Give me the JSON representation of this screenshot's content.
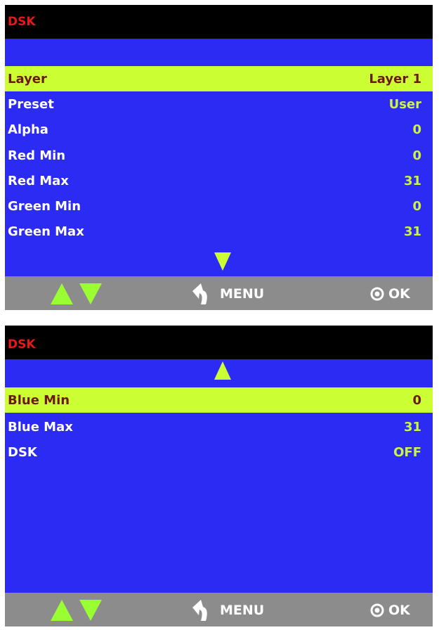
{
  "colors": {
    "screen_bg": "#2b2bf3",
    "title_bg": "#000000",
    "title_text": "#e81818",
    "selected_bg": "#ccff33",
    "selected_text": "#6b1a0e",
    "value_text": "#ccf542",
    "bottom_bar": "#8c8c8c"
  },
  "screen1": {
    "title": "DSK",
    "items": [
      {
        "label": "Layer",
        "value": "Layer 1",
        "selected": true
      },
      {
        "label": "Preset",
        "value": "User"
      },
      {
        "label": "Alpha",
        "value": "0"
      },
      {
        "label": "Red Min",
        "value": "0"
      },
      {
        "label": "Red Max",
        "value": "31"
      },
      {
        "label": "Green Min",
        "value": "0"
      },
      {
        "label": "Green Max",
        "value": "31"
      }
    ],
    "scroll_indicator": "down-arrow-icon"
  },
  "screen2": {
    "title": "DSK",
    "items": [
      {
        "label": "Blue Min",
        "value": "0",
        "selected": true
      },
      {
        "label": "Blue Max",
        "value": "31"
      },
      {
        "label": "DSK",
        "value": "OFF"
      }
    ],
    "scroll_indicator": "up-arrow-icon"
  },
  "bottom_bar": {
    "menu_label": "MENU",
    "ok_label": "OK",
    "icons": [
      "up-arrow-icon",
      "down-arrow-icon",
      "back-arrow-icon",
      "ok-circle-icon"
    ]
  }
}
